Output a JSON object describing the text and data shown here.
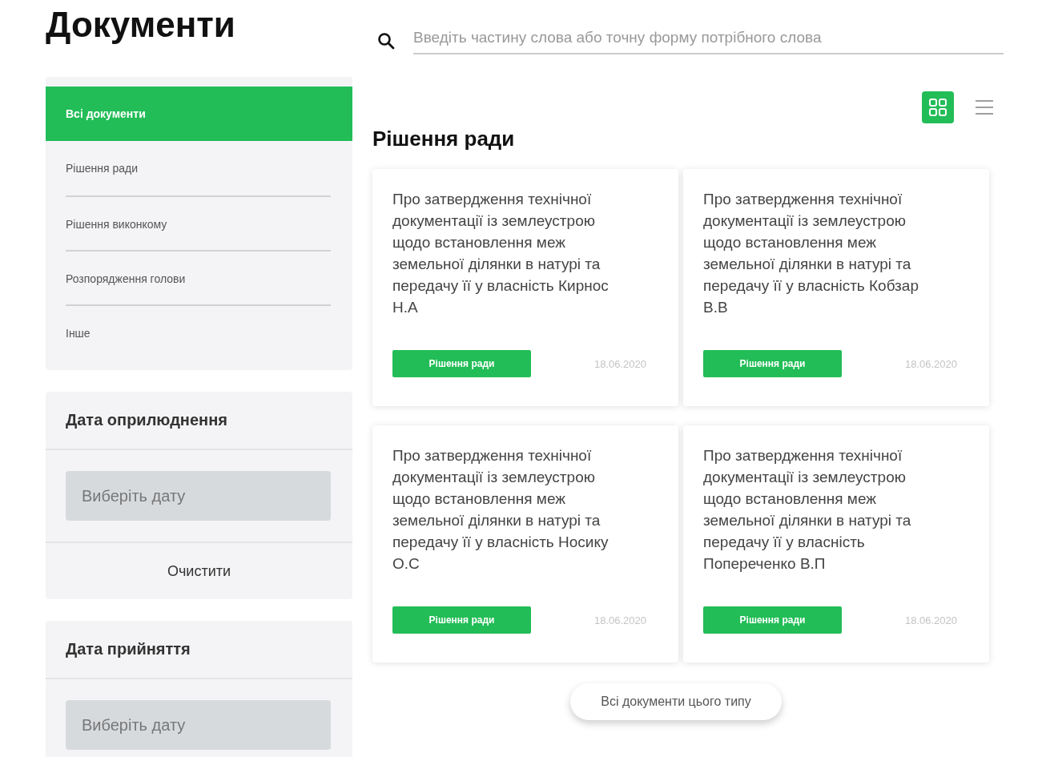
{
  "title": "Документи",
  "search": {
    "placeholder": "Введіть частину слова або точну форму потрібного слова"
  },
  "categories": [
    {
      "label": "Всі документи",
      "selected": true
    },
    {
      "label": "Рішення ради",
      "selected": false
    },
    {
      "label": "Рішення виконкому",
      "selected": false
    },
    {
      "label": "Розпорядження голови",
      "selected": false
    },
    {
      "label": "Інше",
      "selected": false
    }
  ],
  "filters": [
    {
      "title": "Дата оприлюднення",
      "placeholder": "Виберіть дату",
      "clear": "Очистити"
    },
    {
      "title": "Дата прийняття",
      "placeholder": "Виберіть дату"
    }
  ],
  "views": [
    {
      "kind": "grid",
      "selected": true
    },
    {
      "kind": "list",
      "selected": false
    }
  ],
  "section_title": "Рішення ради",
  "documents": [
    {
      "title": "Про затвердження технічної документації із землеустрою щодо встановлення меж земельної ділянки в натурі та передачу її у власність Кирнос Н.А",
      "tag": "Рішення ради",
      "date": "18.06.2020"
    },
    {
      "title": "Про затвердження технічної документації із землеустрою щодо встановлення меж земельної ділянки в натурі та передачу її у власність Кобзар В.В",
      "tag": "Рішення ради",
      "date": "18.06.2020"
    },
    {
      "title": "Про затвердження технічної документації із землеустрою щодо встановлення меж земельної ділянки в натурі та передачу її у власність Носику О.С",
      "tag": "Рішення ради",
      "date": "18.06.2020"
    },
    {
      "title": "Про затвердження технічної документації із землеустрою щодо встановлення меж земельної ділянки в натурі та передачу її у власність Попереченко В.П",
      "tag": "Рішення ради",
      "date": "18.06.2020"
    }
  ],
  "all_button": "Всі документи цього типу"
}
